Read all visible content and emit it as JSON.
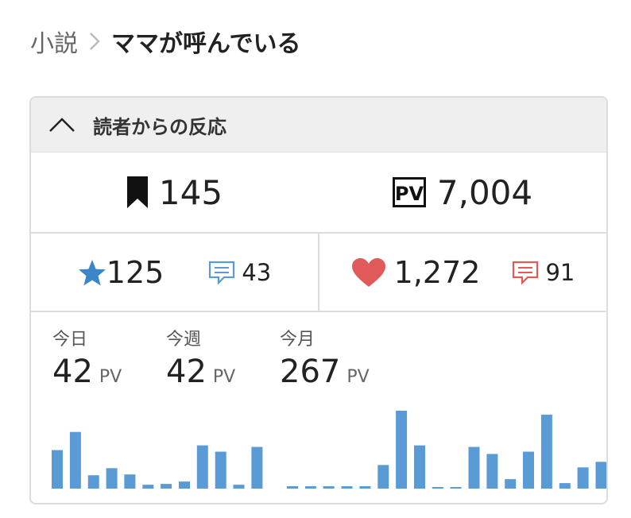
{
  "breadcrumb": {
    "parent": "小説",
    "current": "ママが呼んでいる"
  },
  "panel": {
    "header_label": "読者からの反応",
    "bookmarks": "145",
    "pv_total": "7,004",
    "stars": "125",
    "star_comments": "43",
    "hearts": "1,272",
    "heart_comments": "91"
  },
  "stats": {
    "today_label": "今日",
    "today_value": "42",
    "today_unit": "PV",
    "week_label": "今週",
    "week_value": "42",
    "week_unit": "PV",
    "month_label": "今月",
    "month_value": "267",
    "month_unit": "PV"
  },
  "colors": {
    "accent_blue": "#5b9bd5",
    "heart_red": "#e05a5a",
    "star_blue": "#3a86c8"
  },
  "chart_data": {
    "type": "bar",
    "series": [
      {
        "values": [
          49,
          72,
          17,
          26,
          18,
          5,
          6,
          9,
          55,
          47,
          5,
          53
        ]
      },
      {
        "values": [
          3,
          3,
          3,
          3,
          3,
          30,
          99,
          55,
          2,
          2,
          53,
          44,
          12,
          47,
          94,
          7,
          27,
          34
        ]
      }
    ]
  }
}
